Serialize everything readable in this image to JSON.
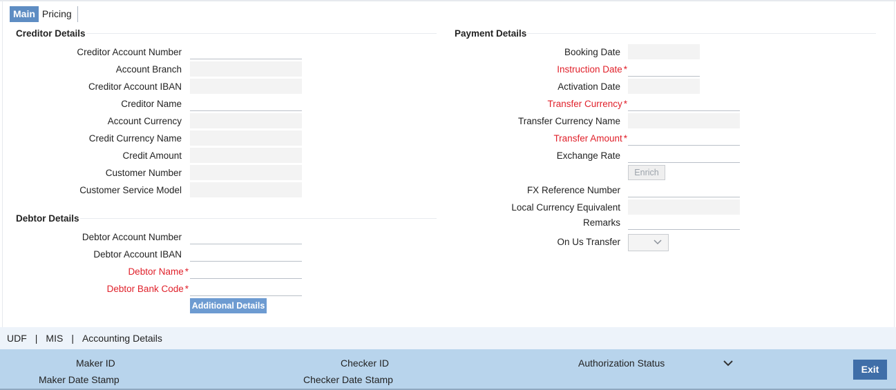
{
  "tabs": {
    "main": "Main",
    "pricing": "Pricing"
  },
  "creditor": {
    "title": "Creditor Details",
    "account_number": "Creditor Account Number",
    "account_branch": "Account Branch",
    "account_iban": "Creditor Account IBAN",
    "name": "Creditor Name",
    "account_currency": "Account Currency",
    "credit_currency_name": "Credit Currency Name",
    "credit_amount": "Credit Amount",
    "customer_number": "Customer Number",
    "customer_service_model": "Customer Service Model"
  },
  "debtor": {
    "title": "Debtor Details",
    "account_number": "Debtor Account Number",
    "account_iban": "Debtor Account IBAN",
    "name": "Debtor Name",
    "bank_code": "Debtor Bank Code",
    "additional_details_button": "Additional Details"
  },
  "payment": {
    "title": "Payment Details",
    "booking_date": "Booking Date",
    "instruction_date": "Instruction Date",
    "activation_date": "Activation Date",
    "transfer_currency": "Transfer Currency",
    "transfer_currency_name": "Transfer Currency Name",
    "transfer_amount": "Transfer Amount",
    "exchange_rate": "Exchange Rate",
    "enrich_button": "Enrich",
    "fx_reference_number": "FX Reference Number",
    "local_currency_equivalent": "Local Currency Equivalent",
    "remarks": "Remarks",
    "on_us_transfer": "On Us Transfer",
    "on_us_transfer_value": ""
  },
  "required_marker": "*",
  "footer_links": {
    "udf": "UDF",
    "mis": "MIS",
    "accounting_details": "Accounting Details",
    "separator": "|"
  },
  "audit": {
    "maker_id": "Maker ID",
    "maker_date_stamp": "Maker Date Stamp",
    "checker_id": "Checker ID",
    "checker_date_stamp": "Checker Date Stamp",
    "authorization_status": "Authorization Status",
    "exit_button": "Exit"
  },
  "colors": {
    "tab_active": "#5e8dc3",
    "required": "#e0202a",
    "audit_bar": "#b8d4ec",
    "exit_button": "#3f6ea8"
  }
}
